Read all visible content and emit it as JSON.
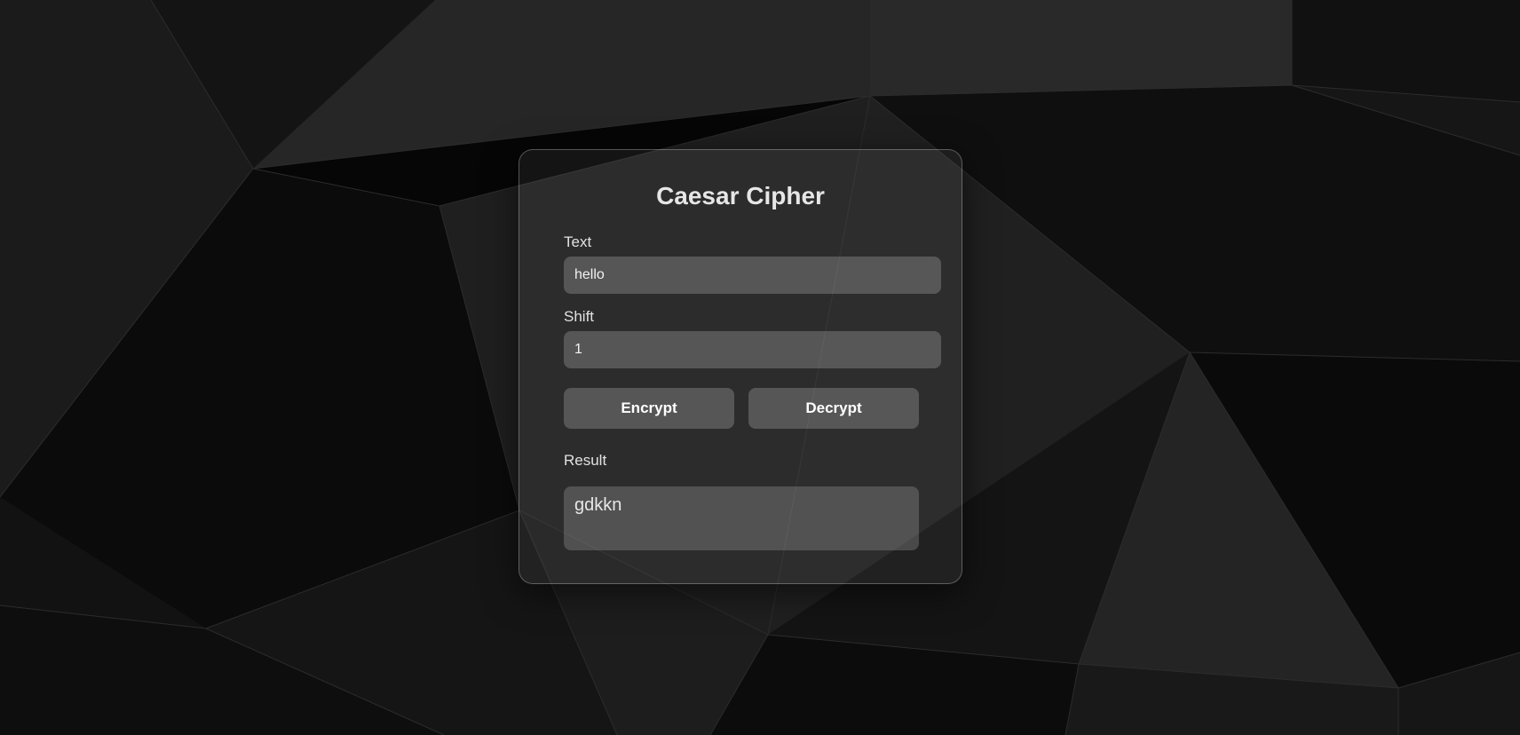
{
  "app": {
    "title": "Caesar Cipher"
  },
  "form": {
    "text_label": "Text",
    "text_value": "hello",
    "shift_label": "Shift",
    "shift_value": "1"
  },
  "actions": {
    "encrypt_label": "Encrypt",
    "decrypt_label": "Decrypt"
  },
  "output": {
    "result_label": "Result",
    "result_value": "gdkkn"
  },
  "colors": {
    "background": "#141414",
    "text": "#e6e6e6",
    "accent_glass": "rgba(255,255,255,0.2)"
  }
}
